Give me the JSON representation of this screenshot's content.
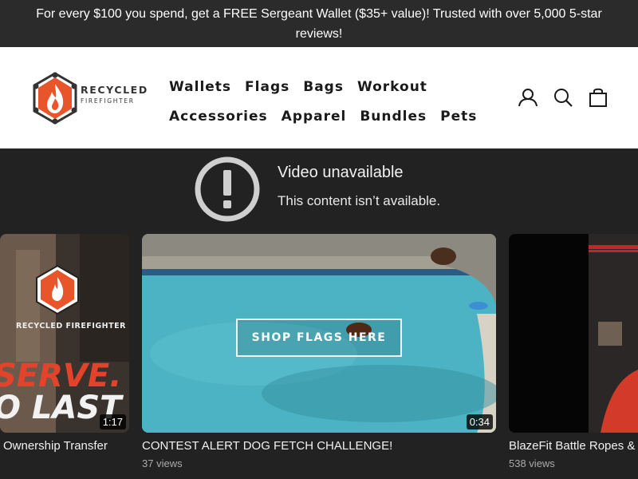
{
  "announcement": {
    "text": "For every $100 you spend, get a FREE Sergeant Wallet ($35+ value)! Trusted with over 5,000 5-star reviews!"
  },
  "header": {
    "logo": {
      "line1": "RECYCLED",
      "line2": "FIREFIGHTER"
    },
    "nav": {
      "row1": [
        "Wallets",
        "Flags",
        "Bags",
        "Workout"
      ],
      "row2": [
        "Accessories",
        "Apparel",
        "Bundles",
        "Pets"
      ]
    },
    "icons": [
      "account-icon",
      "search-icon",
      "cart-icon"
    ]
  },
  "video": {
    "unavailable_title": "Video unavailable",
    "unavailable_message": "This content isn’t available."
  },
  "cards": [
    {
      "title": "Ownership Transfer",
      "duration": "1:17",
      "thumb_logo_text": "RECYCLED FIREFIGHTER",
      "thumb_text_line1": "SERVE.",
      "thumb_text_line2": "O LAST"
    },
    {
      "title": " CONTEST ALERT  DOG FETCH CHALLENGE! ",
      "views": "37 views",
      "duration": "0:34",
      "overlay_button": "SHOP FLAGS HERE"
    },
    {
      "title": "BlazeFit Battle Ropes &",
      "views": "538 views"
    }
  ],
  "colors": {
    "announcement_bg": "#2b2b2b",
    "page_bg": "#222222",
    "brand_orange": "#e8552a",
    "serve_red": "#e2432a"
  }
}
